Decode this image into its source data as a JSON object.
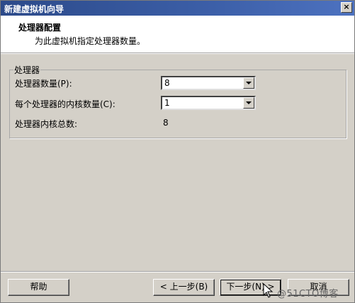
{
  "window": {
    "title": "新建虚拟机向导",
    "close_label": "×"
  },
  "header": {
    "title": "处理器配置",
    "subtitle": "为此虚拟机指定处理器数量。"
  },
  "group": {
    "legend": "处理器",
    "processor_count_label": "处理器数量(P):",
    "processor_count_value": "8",
    "cores_per_processor_label": "每个处理器的内核数量(C):",
    "cores_per_processor_value": "1",
    "total_cores_label": "处理器内核总数:",
    "total_cores_value": "8"
  },
  "footer": {
    "help_label": "帮助",
    "back_label": "< 上一步(B)",
    "next_label": "下一步(N) >",
    "cancel_label": "取消"
  },
  "watermark": "@51CTO博客"
}
